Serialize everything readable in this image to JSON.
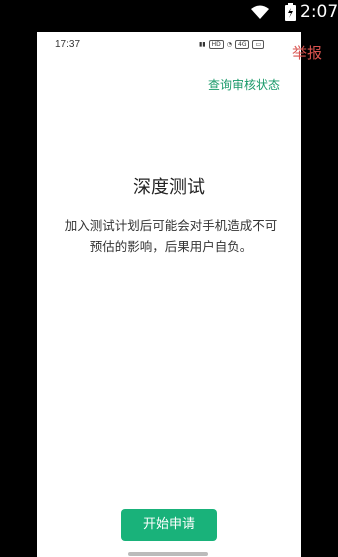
{
  "outer_status": {
    "time": "2:07",
    "icons": [
      "wifi-icon",
      "battery-icon"
    ]
  },
  "inner_status": {
    "time": "17:37",
    "icons": [
      "signal-icon",
      "hd-icon",
      "wifi-icon",
      "4g-icon",
      "battery-icon"
    ]
  },
  "report_label": "举报",
  "query_status_link": "查询审核状态",
  "title": "深度测试",
  "description": "加入测试计划后可能会对手机造成不可预估的影响，后果用户自负。",
  "start_button": "开始申请",
  "colors": {
    "accent": "#19b27a",
    "link": "#1a9a6a",
    "report": "#d9534f"
  }
}
